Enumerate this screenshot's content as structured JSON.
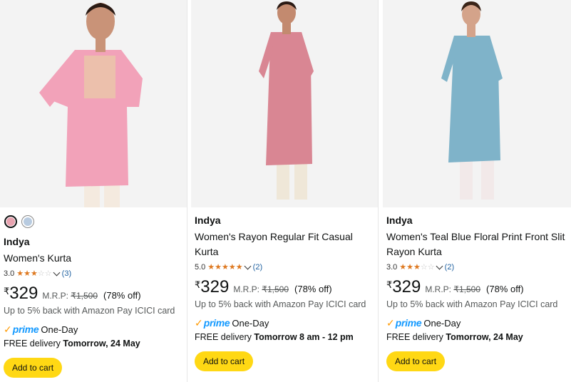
{
  "products": [
    {
      "brand": "Indya",
      "title": "Women's Kurta",
      "rating": "3.0",
      "stars": 3,
      "review_count": "(3)",
      "currency": "₹",
      "price": "329",
      "mrp_label": "M.R.P:",
      "mrp": "₹1,500",
      "discount": "(78% off)",
      "cashback": "Up to 5% back with Amazon Pay ICICI card",
      "prime_label": "prime",
      "one_day": "One-Day",
      "delivery_prefix": "FREE delivery",
      "delivery_date": "Tomorrow, 24 May",
      "cart_label": "Add to cart",
      "swatches": [
        "#e8a3b0",
        "#b8cbe0"
      ],
      "image_color": "#f0a0b8"
    },
    {
      "brand": "Indya",
      "title": "Women's Rayon Regular Fit Casual Kurta",
      "rating": "5.0",
      "stars": 5,
      "review_count": "(2)",
      "currency": "₹",
      "price": "329",
      "mrp_label": "M.R.P:",
      "mrp": "₹1,500",
      "discount": "(78% off)",
      "cashback": "Up to 5% back with Amazon Pay ICICI card",
      "prime_label": "prime",
      "one_day": "One-Day",
      "delivery_prefix": "FREE delivery",
      "delivery_date": "Tomorrow 8 am - 12 pm",
      "cart_label": "Add to cart",
      "image_color": "#d9868f"
    },
    {
      "brand": "Indya",
      "title": "Women's Teal Blue Floral Print Front Slit Rayon Kurta",
      "rating": "3.0",
      "stars": 3,
      "review_count": "(2)",
      "currency": "₹",
      "price": "329",
      "mrp_label": "M.R.P:",
      "mrp": "₹1,500",
      "discount": "(78% off)",
      "cashback": "Up to 5% back with Amazon Pay ICICI card",
      "prime_label": "prime",
      "one_day": "One-Day",
      "delivery_prefix": "FREE delivery",
      "delivery_date": "Tomorrow, 24 May",
      "cart_label": "Add to cart",
      "image_color": "#7fb3c9"
    }
  ]
}
